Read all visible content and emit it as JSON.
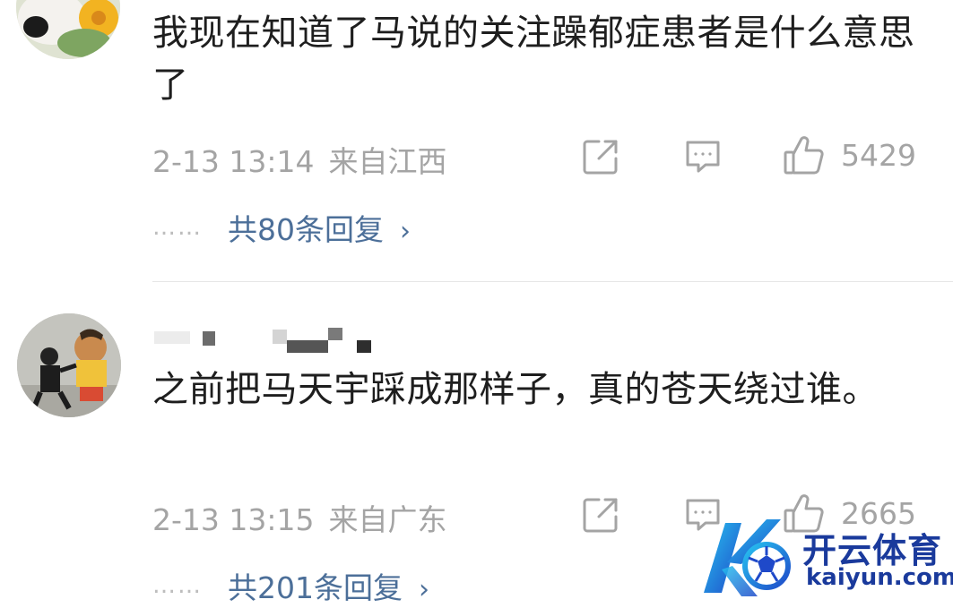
{
  "comments": [
    {
      "text": "我现在知道了马说的关注躁郁症患者是什么意思了",
      "time": "2-13 13:14",
      "location": "来自江西",
      "likes": "5429",
      "replies": "共80条回复",
      "reply_dots": "……",
      "reply_chevron": "›"
    },
    {
      "text": "之前把马天宇踩成那样子，真的苍天绕过谁。",
      "time": "2-13 13:15",
      "location": "来自广东",
      "likes": "2665",
      "replies": "共201条回复",
      "reply_dots": "……",
      "reply_chevron": "›"
    }
  ],
  "icons": {
    "share": "share-icon",
    "comment": "comment-icon",
    "like": "thumbs-up-icon"
  },
  "watermark": {
    "brand": "开云体育",
    "url": "kaiyun.com"
  },
  "colors": {
    "text": "#1e1e1e",
    "meta": "#a4a4a4",
    "link": "#4c6f99",
    "watermark": "#1a3a9c"
  }
}
